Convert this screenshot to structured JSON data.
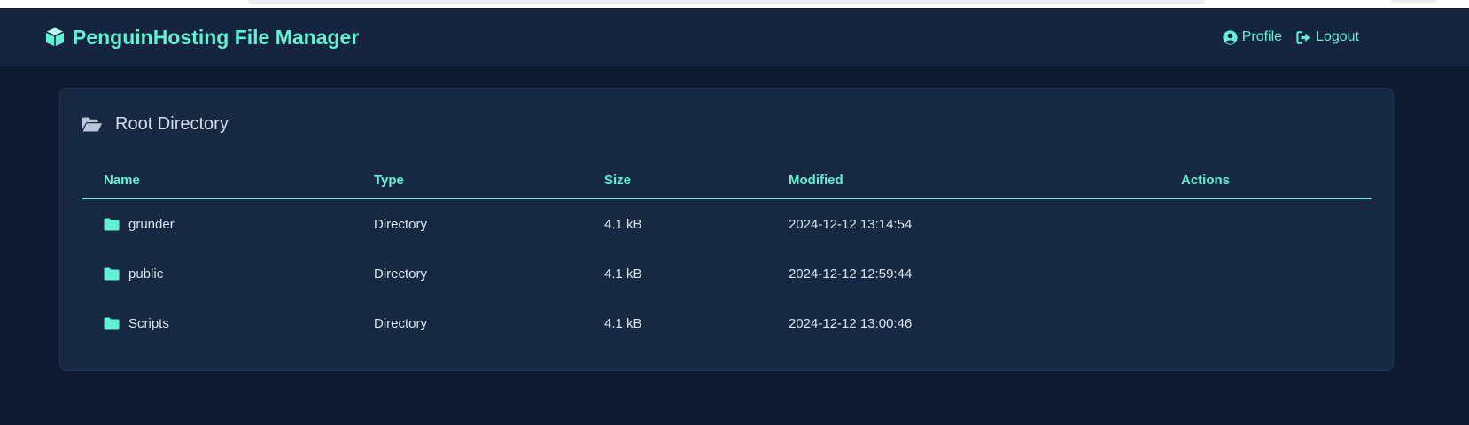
{
  "navbar": {
    "brand_icon": "cube-icon",
    "brand_title": "PenguinHosting File Manager",
    "links": [
      {
        "label": "Profile",
        "icon": "user-circle-icon"
      },
      {
        "label": "Logout",
        "icon": "sign-out-icon"
      }
    ]
  },
  "panel": {
    "icon": "folder-open-icon",
    "title": "Root Directory"
  },
  "table": {
    "columns": [
      "Name",
      "Type",
      "Size",
      "Modified",
      "Actions"
    ],
    "rows": [
      {
        "icon": "folder-icon",
        "name": "grunder",
        "type": "Directory",
        "size": "4.1 kB",
        "modified": "2024-12-12 13:14:54"
      },
      {
        "icon": "folder-icon",
        "name": "public",
        "type": "Directory",
        "size": "4.1 kB",
        "modified": "2024-12-12 12:59:44"
      },
      {
        "icon": "folder-icon",
        "name": "Scripts",
        "type": "Directory",
        "size": "4.1 kB",
        "modified": "2024-12-12 13:00:46"
      }
    ]
  },
  "colors": {
    "accent": "#5ff2d4",
    "background": "#0d1a30",
    "navbar": "#16253f",
    "card": "#162842"
  }
}
